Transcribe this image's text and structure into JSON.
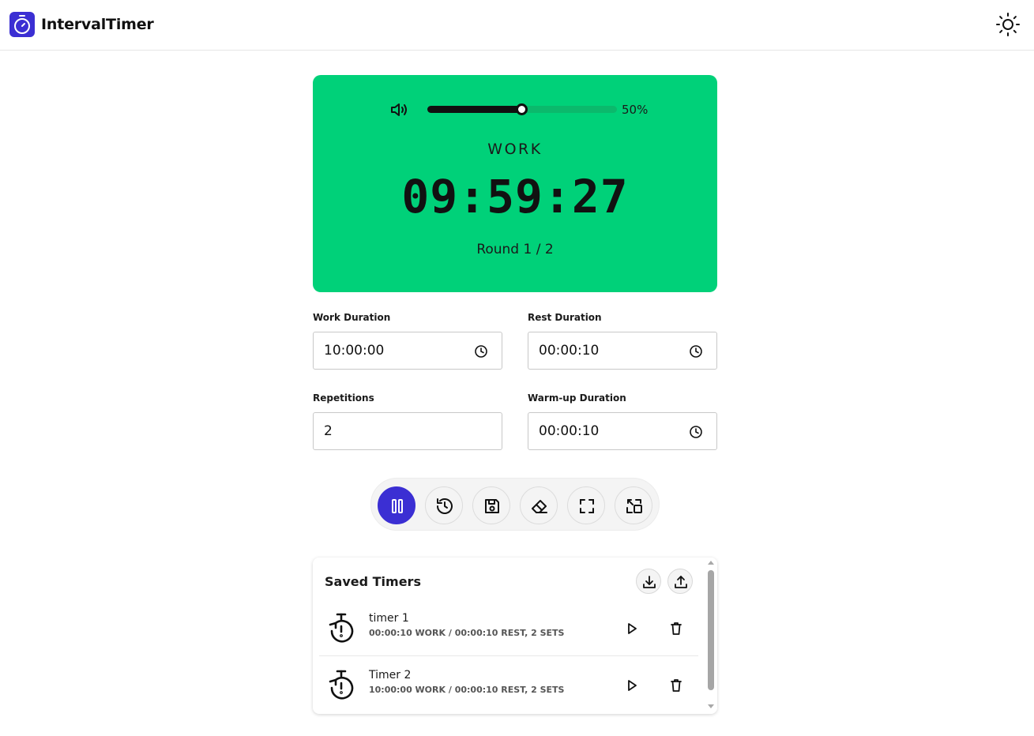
{
  "app": {
    "title": "IntervalTimer"
  },
  "header": {
    "logo_icon": "stopwatch-icon",
    "theme_icon": "sun-icon"
  },
  "timer": {
    "background": "#00d179",
    "volume": {
      "icon": "speaker-icon",
      "percent": 0.5,
      "label": "50%"
    },
    "phase": "WORK",
    "time": "09:59:27",
    "round": "Round 1 / 2"
  },
  "fields": {
    "work_duration": {
      "label": "Work Duration",
      "value": "10:00:00"
    },
    "rest_duration": {
      "label": "Rest Duration",
      "value": "00:00:10"
    },
    "repetitions": {
      "label": "Repetitions",
      "value": "2"
    },
    "warmup_duration": {
      "label": "Warm-up Duration",
      "value": "00:00:10"
    }
  },
  "toolbar": {
    "accent": "#3b2fd3",
    "buttons": [
      "pause-icon",
      "history-icon",
      "save-icon",
      "eraser-icon",
      "fullscreen-icon",
      "switch-icon"
    ]
  },
  "saved": {
    "title": "Saved Timers",
    "actions": [
      "download-icon",
      "upload-icon"
    ],
    "items": [
      {
        "name": "timer 1",
        "summary": "00:00:10 WORK / 00:00:10 REST, 2 SETS"
      },
      {
        "name": "Timer 2",
        "summary": "10:00:00 WORK / 00:00:10 REST, 2 SETS"
      }
    ]
  }
}
